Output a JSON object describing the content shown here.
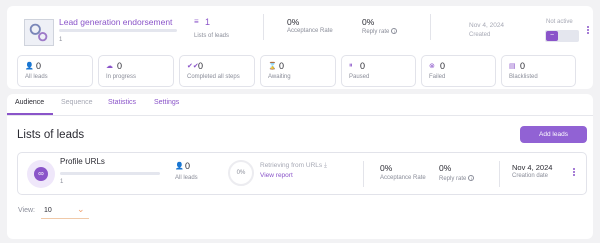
{
  "campaign": {
    "title": "Lead generation endorsement",
    "count": "1",
    "lists_count": "1",
    "lists_label": "Lists of leads",
    "acceptance_value": "0%",
    "acceptance_label": "Acceptance Rate",
    "reply_value": "0%",
    "reply_label": "Reply rate",
    "created_date": "Nov 4, 2024",
    "created_label": "Created",
    "status_label": "Not active",
    "toggle_symbol": "−"
  },
  "stats": [
    {
      "icon": "user-icon",
      "glyph": "👤",
      "value": "0",
      "label": "All leads"
    },
    {
      "icon": "in-progress-icon",
      "glyph": "☁",
      "value": "0",
      "label": "In progress"
    },
    {
      "icon": "double-check-icon",
      "glyph": "✔✔",
      "value": "0",
      "label": "Completed all steps"
    },
    {
      "icon": "hourglass-icon",
      "glyph": "⌛",
      "value": "0",
      "label": "Awaiting"
    },
    {
      "icon": "pause-icon",
      "glyph": "⏸",
      "value": "0",
      "label": "Paused"
    },
    {
      "icon": "x-circle-icon",
      "glyph": "⊗",
      "value": "0",
      "label": "Failed"
    },
    {
      "icon": "blacklist-icon",
      "glyph": "▤",
      "value": "0",
      "label": "Blacklisted"
    }
  ],
  "tabs": {
    "audience": "Audience",
    "sequence": "Sequence",
    "statistics": "Statistics",
    "settings": "Settings"
  },
  "lists_section": {
    "title": "Lists of leads",
    "add_button": "Add leads"
  },
  "list_item": {
    "name": "Profile URLs",
    "count": "1",
    "leads_value": "0",
    "leads_label": "All leads",
    "progress": "0%",
    "retrieving_text": "Retrieving from URLs",
    "view_report": "View report",
    "acceptance_value": "0%",
    "acceptance_label": "Acceptance Rate",
    "reply_value": "0%",
    "reply_label": "Reply rate",
    "date": "Nov 4, 2024",
    "date_label": "Creation date"
  },
  "view": {
    "label": "View:",
    "value": "10"
  },
  "colors": {
    "accent": "#8a54c9",
    "button": "#9162d4",
    "underline_view": "#f0b48a"
  }
}
